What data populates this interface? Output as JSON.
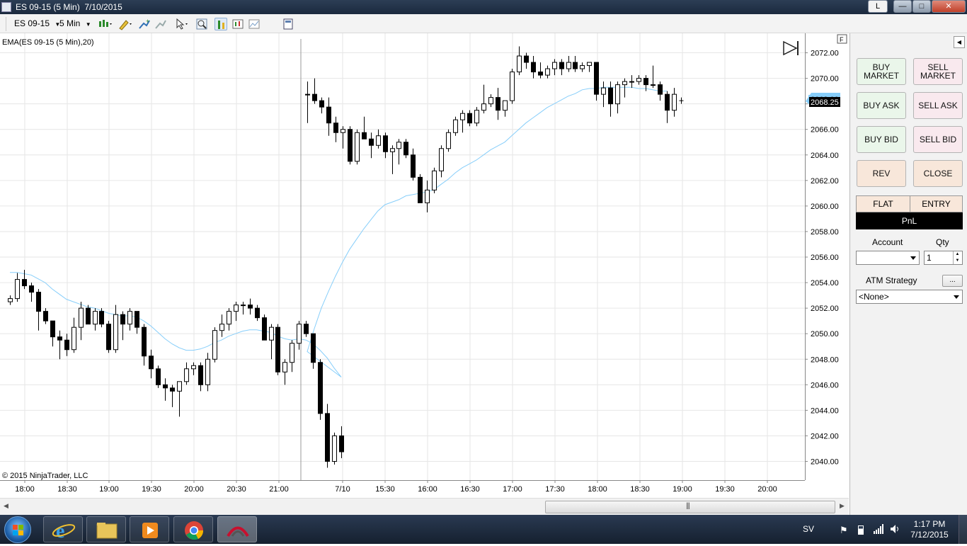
{
  "window": {
    "title": "ES 09-15 (5 Min)  7/10/2015",
    "buttons": {
      "link": "L",
      "minimize": "—",
      "maximize": "□",
      "close": "✕"
    }
  },
  "toolbar": {
    "instrument": "ES 09-15",
    "interval": "5 Min",
    "icons": [
      "candlestick-style-icon",
      "draw-pencil-icon",
      "add-indicator-icon",
      "strategy-icon",
      "cursor-icon",
      "zoom-icon",
      "bar-chart-icon",
      "data-series-icon",
      "chart-properties-icon",
      "template-icon"
    ]
  },
  "chart": {
    "indicator_label": "EMA(ES 09-15 (5 Min),20)",
    "copyright": "© 2015 NinjaTrader, LLC",
    "current_price_label": "2068.25",
    "behind_price_label": "2068.00",
    "f_button": "F",
    "colors": {
      "up_fill": "#ffffff",
      "down_fill": "#000000",
      "ema": "#87cefa",
      "price_box": "#000000",
      "grid": "#e6e6e6"
    }
  },
  "chart_data": {
    "type": "candlestick",
    "ylim": [
      2039.3,
      2074.7
    ],
    "y_ticks": [
      "2072.00",
      "2070.00",
      "2068.00",
      "2066.00",
      "2064.00",
      "2062.00",
      "2060.00",
      "2058.00",
      "2056.00",
      "2054.00",
      "2052.00",
      "2050.00",
      "2048.00",
      "2046.00",
      "2044.00",
      "2042.00",
      "2040.00"
    ],
    "x_ticks": [
      "18:00",
      "18:30",
      "19:00",
      "19:30",
      "20:00",
      "20:30",
      "21:00",
      "7/10",
      "15:30",
      "16:00",
      "16:30",
      "17:00",
      "17:30",
      "18:00",
      "18:30",
      "19:00",
      "19:30",
      "20:00"
    ],
    "session_break_label": "7/10",
    "candles": [
      [
        2052.5,
        2053.0,
        2052.25,
        2052.75
      ],
      [
        2052.75,
        2054.75,
        2052.5,
        2054.25
      ],
      [
        2054.25,
        2055.0,
        2053.5,
        2053.75
      ],
      [
        2053.75,
        2054.0,
        2052.5,
        2053.25
      ],
      [
        2053.25,
        2053.5,
        2050.25,
        2051.75
      ],
      [
        2051.75,
        2052.0,
        2050.75,
        2051.0
      ],
      [
        2051.0,
        2051.0,
        2049.0,
        2049.75
      ],
      [
        2049.75,
        2050.25,
        2048.0,
        2049.5
      ],
      [
        2049.5,
        2050.0,
        2048.25,
        2048.75
      ],
      [
        2048.75,
        2051.25,
        2048.5,
        2050.5
      ],
      [
        2050.5,
        2052.5,
        2049.5,
        2052.0
      ],
      [
        2052.0,
        2052.25,
        2050.75,
        2050.75
      ],
      [
        2050.75,
        2052.0,
        2050.25,
        2051.75
      ],
      [
        2051.75,
        2052.0,
        2050.5,
        2050.75
      ],
      [
        2050.75,
        2051.0,
        2048.5,
        2048.75
      ],
      [
        2048.75,
        2052.25,
        2048.5,
        2051.5
      ],
      [
        2051.5,
        2051.75,
        2049.5,
        2050.75
      ],
      [
        2050.75,
        2052.0,
        2050.25,
        2051.75
      ],
      [
        2051.75,
        2051.75,
        2050.0,
        2050.5
      ],
      [
        2050.5,
        2050.75,
        2047.5,
        2048.25
      ],
      [
        2048.25,
        2048.75,
        2046.5,
        2047.25
      ],
      [
        2047.25,
        2047.5,
        2045.75,
        2046.0
      ],
      [
        2046.0,
        2046.5,
        2044.75,
        2045.75
      ],
      [
        2045.75,
        2046.0,
        2044.25,
        2045.5
      ],
      [
        2045.5,
        2046.25,
        2043.5,
        2046.25
      ],
      [
        2046.25,
        2047.75,
        2046.0,
        2047.25
      ],
      [
        2047.25,
        2047.75,
        2046.75,
        2047.5
      ],
      [
        2047.5,
        2047.75,
        2045.5,
        2046.0
      ],
      [
        2046.0,
        2048.5,
        2045.5,
        2048.0
      ],
      [
        2048.0,
        2050.5,
        2047.75,
        2050.25
      ],
      [
        2050.25,
        2051.5,
        2049.75,
        2050.75
      ],
      [
        2050.75,
        2052.0,
        2050.25,
        2051.75
      ],
      [
        2051.75,
        2052.5,
        2051.0,
        2052.25
      ],
      [
        2052.25,
        2052.5,
        2051.5,
        2052.25
      ],
      [
        2052.25,
        2052.75,
        2051.5,
        2052.0
      ],
      [
        2052.0,
        2052.25,
        2051.0,
        2051.25
      ],
      [
        2051.25,
        2051.5,
        2049.5,
        2049.5
      ],
      [
        2049.5,
        2050.75,
        2048.0,
        2050.5
      ],
      [
        2050.5,
        2050.75,
        2046.75,
        2047.0
      ],
      [
        2047.0,
        2048.0,
        2046.0,
        2047.75
      ],
      [
        2047.75,
        2049.5,
        2047.0,
        2049.25
      ],
      [
        2049.25,
        2051.0,
        2048.75,
        2050.75
      ],
      [
        2050.75,
        2051.0,
        2049.75,
        2050.0
      ],
      [
        2050.0,
        2050.0,
        2047.25,
        2047.75
      ],
      [
        2047.75,
        2048.0,
        2043.25,
        2043.75
      ],
      [
        2043.75,
        2044.5,
        2039.5,
        2040.0
      ],
      [
        2040.0,
        2042.25,
        2039.75,
        2042.0
      ],
      [
        2042.0,
        2042.75,
        2040.25,
        2040.75
      ],
      [
        2068.75,
        2069.75,
        2066.5,
        2068.75
      ],
      [
        2068.75,
        2070.0,
        2068.0,
        2068.25
      ],
      [
        2068.25,
        2068.5,
        2067.25,
        2067.75
      ],
      [
        2067.75,
        2068.5,
        2065.5,
        2066.5
      ],
      [
        2066.5,
        2067.0,
        2065.0,
        2065.75
      ],
      [
        2065.75,
        2066.25,
        2064.5,
        2066.0
      ],
      [
        2066.0,
        2066.25,
        2063.25,
        2063.5
      ],
      [
        2063.5,
        2066.0,
        2063.25,
        2065.75
      ],
      [
        2065.75,
        2067.0,
        2065.25,
        2065.25
      ],
      [
        2065.25,
        2065.75,
        2063.75,
        2064.75
      ],
      [
        2064.75,
        2066.0,
        2064.5,
        2065.5
      ],
      [
        2065.5,
        2065.75,
        2063.75,
        2064.25
      ],
      [
        2064.25,
        2064.75,
        2062.5,
        2064.5
      ],
      [
        2064.5,
        2065.25,
        2063.25,
        2065.0
      ],
      [
        2065.0,
        2065.25,
        2063.75,
        2064.0
      ],
      [
        2064.0,
        2064.5,
        2062.0,
        2062.25
      ],
      [
        2062.25,
        2062.5,
        2060.25,
        2060.25
      ],
      [
        2060.25,
        2062.0,
        2059.5,
        2061.25
      ],
      [
        2061.25,
        2063.0,
        2061.0,
        2062.75
      ],
      [
        2062.75,
        2064.75,
        2062.25,
        2064.5
      ],
      [
        2064.5,
        2066.0,
        2064.25,
        2065.75
      ],
      [
        2065.75,
        2067.0,
        2065.5,
        2066.75
      ],
      [
        2066.75,
        2067.5,
        2065.75,
        2067.25
      ],
      [
        2067.25,
        2067.5,
        2066.25,
        2066.5
      ],
      [
        2066.5,
        2067.75,
        2066.25,
        2067.5
      ],
      [
        2067.5,
        2069.5,
        2067.25,
        2068.0
      ],
      [
        2068.0,
        2068.75,
        2067.75,
        2068.5
      ],
      [
        2068.5,
        2069.25,
        2066.75,
        2067.5
      ],
      [
        2067.5,
        2068.25,
        2067.0,
        2068.25
      ],
      [
        2068.25,
        2070.75,
        2068.0,
        2070.5
      ],
      [
        2070.5,
        2072.5,
        2070.25,
        2071.75
      ],
      [
        2071.75,
        2072.0,
        2070.75,
        2071.25
      ],
      [
        2071.25,
        2071.75,
        2070.0,
        2070.5
      ],
      [
        2070.5,
        2071.25,
        2070.0,
        2070.25
      ],
      [
        2070.25,
        2071.0,
        2070.0,
        2070.75
      ],
      [
        2070.75,
        2071.5,
        2070.25,
        2071.25
      ],
      [
        2071.25,
        2071.5,
        2070.25,
        2070.75
      ],
      [
        2070.75,
        2071.75,
        2070.5,
        2071.25
      ],
      [
        2071.25,
        2071.75,
        2070.5,
        2070.75
      ],
      [
        2070.75,
        2071.25,
        2070.5,
        2071.0
      ],
      [
        2071.0,
        2071.0,
        2070.5,
        2071.25
      ],
      [
        2071.25,
        2071.25,
        2068.25,
        2068.75
      ],
      [
        2068.75,
        2069.75,
        2067.75,
        2069.25
      ],
      [
        2069.25,
        2069.75,
        2067.0,
        2068.0
      ],
      [
        2068.0,
        2069.75,
        2067.25,
        2069.5
      ],
      [
        2069.5,
        2070.0,
        2068.5,
        2069.75
      ],
      [
        2069.75,
        2070.25,
        2069.25,
        2069.75
      ],
      [
        2069.75,
        2070.25,
        2069.5,
        2070.0
      ],
      [
        2070.0,
        2070.25,
        2069.0,
        2069.5
      ],
      [
        2069.5,
        2071.0,
        2069.25,
        2069.5
      ],
      [
        2069.5,
        2069.75,
        2068.25,
        2068.75
      ],
      [
        2068.75,
        2069.0,
        2066.5,
        2067.5
      ],
      [
        2067.5,
        2069.25,
        2067.0,
        2068.75
      ],
      [
        2068.25,
        2068.5,
        2068.0,
        2068.25
      ]
    ],
    "ema20": [
      2054.8,
      2054.8,
      2054.7,
      2054.6,
      2054.3,
      2054.0,
      2053.5,
      2053.1,
      2052.7,
      2052.5,
      2052.3,
      2052.1,
      2052.0,
      2051.8,
      2051.6,
      2051.5,
      2051.4,
      2051.4,
      2051.3,
      2051.0,
      2050.6,
      2050.1,
      2049.6,
      2049.2,
      2048.9,
      2048.7,
      2048.7,
      2048.8,
      2049.0,
      2049.3,
      2049.5,
      2049.8,
      2050.0,
      2050.2,
      2050.3,
      2050.3,
      2050.2,
      2050.1,
      2049.8,
      2049.6,
      2049.5,
      2049.6,
      2049.5,
      2049.2,
      2048.7,
      2048.1,
      2047.3,
      2046.6,
      2048.6,
      2050.4,
      2052.0,
      2053.3,
      2054.5,
      2055.6,
      2056.6,
      2057.4,
      2058.2,
      2058.9,
      2059.6,
      2060.1,
      2060.3,
      2060.5,
      2060.8,
      2060.9,
      2061.0,
      2061.1,
      2061.3,
      2061.7,
      2062.1,
      2062.6,
      2063.0,
      2063.3,
      2063.6,
      2064.0,
      2064.4,
      2064.7,
      2065.0,
      2065.5,
      2066.0,
      2066.5,
      2066.9,
      2067.3,
      2067.7,
      2068.0,
      2068.3,
      2068.6,
      2068.8,
      2069.1,
      2069.2,
      2069.2,
      2069.3,
      2069.3,
      2069.3,
      2069.3,
      2069.3,
      2069.2,
      2069.2,
      2069.1,
      2069.0,
      2069.0
    ]
  },
  "order_panel": {
    "buttons": [
      {
        "id": "buy-market",
        "label": "BUY\nMARKET"
      },
      {
        "id": "sell-market",
        "label": "SELL\nMARKET"
      },
      {
        "id": "buy-ask",
        "label": "BUY ASK"
      },
      {
        "id": "sell-ask",
        "label": "SELL ASK"
      },
      {
        "id": "buy-bid",
        "label": "BUY BID"
      },
      {
        "id": "sell-bid",
        "label": "SELL BID"
      },
      {
        "id": "rev",
        "label": "REV"
      },
      {
        "id": "close",
        "label": "CLOSE"
      }
    ],
    "position": "FLAT",
    "entry": "ENTRY",
    "pnl": "PnL",
    "account_label": "Account",
    "account_value": "",
    "qty_label": "Qty",
    "qty_value": "1",
    "atm_label": "ATM Strategy",
    "atm_button": "...",
    "atm_value": "<None>"
  },
  "taskbar": {
    "apps": [
      "start-orb",
      "internet-explorer",
      "file-explorer",
      "media-player",
      "chrome",
      "ninjatrader"
    ],
    "language": "SV",
    "time": "1:17 PM",
    "date": "7/12/2015"
  }
}
